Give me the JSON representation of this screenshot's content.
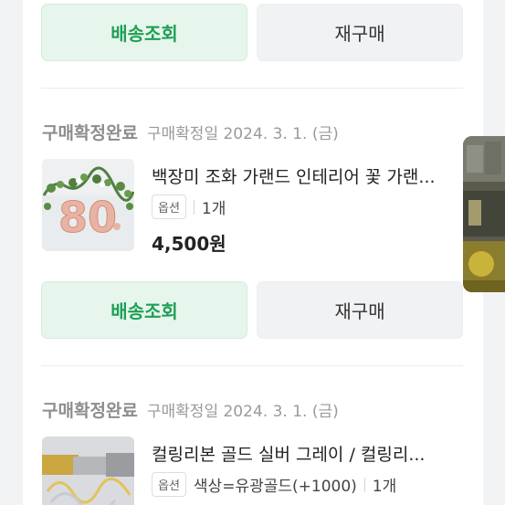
{
  "orders": [
    {
      "delivery_button": "배송조회",
      "reorder_button": "재구매"
    },
    {
      "status": "구매확정완료",
      "confirm_date": "구매확정일 2024. 3. 1. (금)",
      "title": "백장미 조화 가랜드 인테리어 꽃 가랜...",
      "option_tag": "옵션",
      "quantity": "1개",
      "price": "4,500원",
      "delivery_button": "배송조회",
      "reorder_button": "재구매"
    },
    {
      "status": "구매확정완료",
      "confirm_date": "구매확정일 2024. 3. 1. (금)",
      "title": "컬링리본 골드 실버 그레이 / 컬링리...",
      "option_tag": "옵션",
      "option_text": "색상=유광골드(+1000)",
      "quantity": "1개"
    }
  ]
}
